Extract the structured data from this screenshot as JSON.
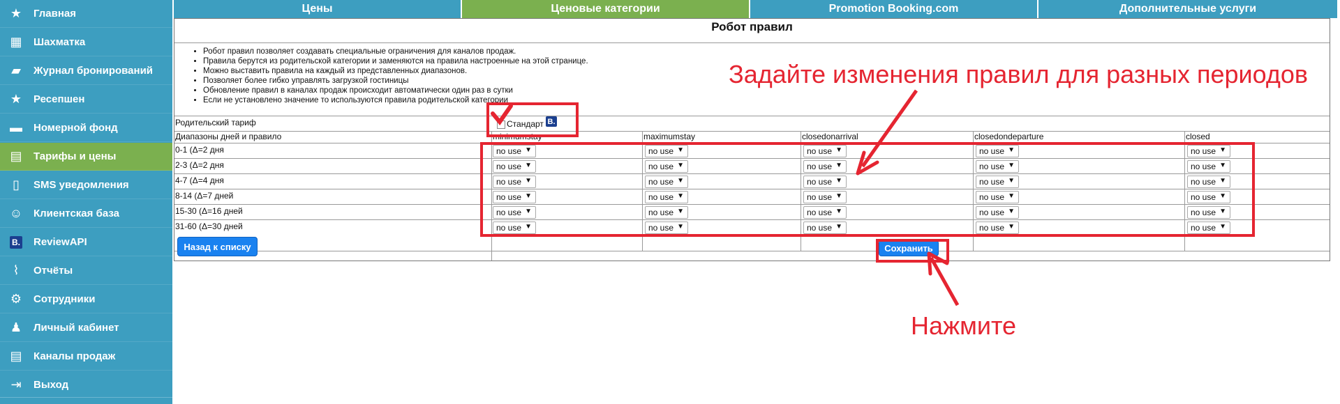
{
  "sidebar": {
    "items": [
      {
        "label": "Главная",
        "icon": "star-icon"
      },
      {
        "label": "Шахматка",
        "icon": "grid-icon"
      },
      {
        "label": "Журнал бронирований",
        "icon": "book-icon"
      },
      {
        "label": "Ресепшен",
        "icon": "star-icon"
      },
      {
        "label": "Номерной фонд",
        "icon": "bed-icon"
      },
      {
        "label": "Тарифы и цены",
        "icon": "money-icon"
      },
      {
        "label": "SMS уведомления",
        "icon": "phone-icon"
      },
      {
        "label": "Клиентская база",
        "icon": "user-icon"
      },
      {
        "label": "ReviewAPI",
        "icon": "booking-icon"
      },
      {
        "label": "Отчёты",
        "icon": "chart-icon"
      },
      {
        "label": "Сотрудники",
        "icon": "gear-icon"
      },
      {
        "label": "Личный кабинет",
        "icon": "person-icon"
      },
      {
        "label": "Каналы продаж",
        "icon": "money-icon"
      },
      {
        "label": "Выход",
        "icon": "exit-icon"
      }
    ],
    "active_index": 5
  },
  "tabs": [
    {
      "label": "Цены"
    },
    {
      "label": "Ценовые категории"
    },
    {
      "label": "Promotion Booking.com"
    },
    {
      "label": "Дополнительные услуги"
    }
  ],
  "page": {
    "title": "Робот правил",
    "notes": [
      "Робот правил позволяет создавать специальные ограничения для каналов продаж.",
      "Правила берутся из родительской категории и заменяются на правила настроенные на этой странице.",
      "Можно выставить правила на каждый из представленных диапазонов.",
      "Позволяет более гибко управлять загрузкой гостиницы",
      "Обновление правил в каналах продаж происходит автоматически один раз в сутки",
      "Если не установлено значение то используются правила родительской категории"
    ],
    "parent_tariff_label": "Родительский тариф",
    "parent_tariff_value": "Стандарт",
    "parent_tariff_badge": "B.",
    "ranges_label": "Диапазоны дней и правило",
    "columns": [
      "minimumstay",
      "maximumstay",
      "closedonarrival",
      "closedondeparture",
      "closed"
    ],
    "rows": [
      {
        "label": "0-1 (Δ=2 дня"
      },
      {
        "label": "2-3 (Δ=2 дня"
      },
      {
        "label": "4-7 (Δ=4 дня"
      },
      {
        "label": "8-14 (Δ=7 дней"
      },
      {
        "label": "15-30 (Δ=16 дней"
      },
      {
        "label": "31-60 (Δ=30 дней"
      }
    ],
    "select_value": "no use",
    "back_button": "Назад к списку",
    "save_button": "Сохранить"
  },
  "annotations": {
    "rules_text": "Задайте изменения правил для разных периодов",
    "click_text": "Нажмите",
    "color": "#e52531"
  },
  "colors": {
    "sidebar": "#3d9ec0",
    "active": "#7bb04f",
    "button": "#1a82f0"
  }
}
